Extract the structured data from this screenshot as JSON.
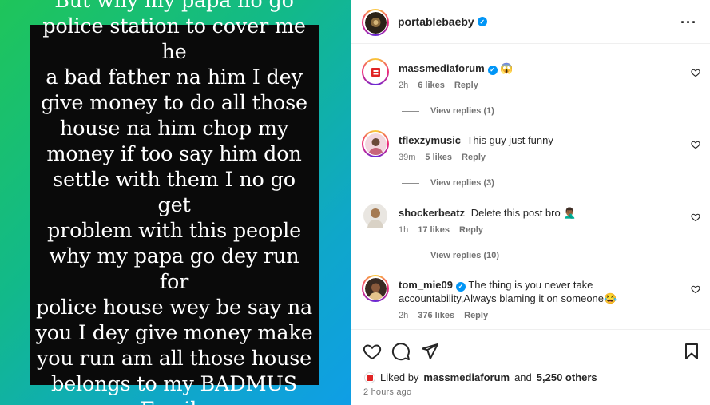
{
  "post": {
    "caption_image_text": "But why my papa no go\npolice station to cover me he\na bad father na him I dey\ngive money to do all those\nhouse na him chop my\nmoney if too say him don\nsettle with them I no go get\nproblem with this people\nwhy my papa go dey run for\npolice house wey be say na\nyou I dey give money make\nyou run am all those house\nbelongs to my BADMUS\nFamily"
  },
  "header": {
    "username": "portablebaeby",
    "more_label": "···"
  },
  "comments": [
    {
      "username": "massmediaforum",
      "text": "😱",
      "time": "2h",
      "likes": "6 likes",
      "reply": "Reply",
      "view_replies": "View replies (1)"
    },
    {
      "username": "tflexzymusic",
      "text": "This guy just funny",
      "time": "39m",
      "likes": "5 likes",
      "reply": "Reply",
      "view_replies": "View replies (3)"
    },
    {
      "username": "shockerbeatz",
      "text": "Delete this post bro 🤦🏾‍♂️",
      "time": "1h",
      "likes": "17 likes",
      "reply": "Reply",
      "view_replies": "View replies (10)"
    },
    {
      "username": "tom_mie09",
      "text": "The thing is you never take accountability,Always blaming it on someone😂",
      "time": "2h",
      "likes": "376 likes",
      "reply": "Reply"
    }
  ],
  "footer": {
    "liked_by_prefix": "Liked by",
    "liked_by_user": "massmediaforum",
    "and": "and",
    "others": "5,250 others",
    "timestamp": "2 hours ago"
  },
  "colors": {
    "verified": "#0095f6",
    "meta_text": "#737373",
    "accent_ring_a": "#ee2a7b",
    "accent_ring_b": "#f9ce34"
  },
  "icons": [
    "heart-icon",
    "comment-icon",
    "share-icon",
    "bookmark-icon",
    "more-icon",
    "verified-icon"
  ]
}
